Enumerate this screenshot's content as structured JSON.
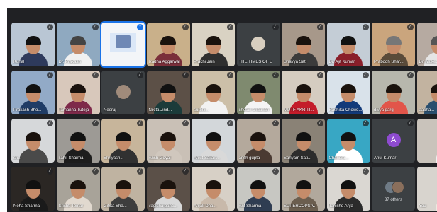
{
  "colors": {
    "grid_background": "#202124",
    "tile_background": "#3c4043",
    "accent_blue": "#1a73e8",
    "avatar_purple": "#8e4bd0"
  },
  "tiles": [
    {
      "name": "Kunal",
      "mic": "muted"
    },
    {
      "name": "Dr. Prakash",
      "mic": "muted"
    },
    {
      "name": "",
      "mic": "active"
    },
    {
      "name": "Radha Aggarwal",
      "mic": "muted"
    },
    {
      "name": "Prachi Jain",
      "mic": "muted"
    },
    {
      "name": "THE TIMES OF US",
      "mic": "muted"
    },
    {
      "name": "Bhavya Sati",
      "mic": "muted"
    },
    {
      "name": "Dr. Ajit Kumar",
      "mic": "muted"
    },
    {
      "name": "Prabodh Shar...",
      "mic": "muted"
    },
    {
      "name": "Dr. Muke...",
      "mic": "muted"
    },
    {
      "name": "Prakash Bho...",
      "mic": "muted"
    },
    {
      "name": "Tamanna Tuteja",
      "mic": "muted"
    },
    {
      "name": "Neeraj",
      "mic": "muted"
    },
    {
      "name": "Nikita Jind...",
      "mic": "muted"
    },
    {
      "name": "surbhi...",
      "mic": "muted"
    },
    {
      "name": "chetan chauhan",
      "mic": "muted"
    },
    {
      "name": "MDTF AKRITI...",
      "mic": "muted"
    },
    {
      "name": "Rashika Chowd...",
      "mic": "muted"
    },
    {
      "name": "divya garg",
      "mic": "muted"
    },
    {
      "name": "aabha...",
      "mic": "muted"
    },
    {
      "name": "sh...",
      "mic": "muted"
    },
    {
      "name": "sahil Sharma",
      "mic": "muted"
    },
    {
      "name": "Shriyash...",
      "mic": "muted"
    },
    {
      "name": "Ansh Goyal",
      "mic": "muted"
    },
    {
      "name": "Ankit Sailan...",
      "mic": "muted"
    },
    {
      "name": "ansh gupta",
      "mic": "muted"
    },
    {
      "name": "Sanyam Sati...",
      "mic": "muted"
    },
    {
      "name": "Chandra...",
      "mic": "muted"
    },
    {
      "name": "Anuj Kumar",
      "mic": "muted"
    },
    {
      "name": "",
      "mic": "muted"
    },
    {
      "name": "Neha Sharma",
      "mic": "muted"
    },
    {
      "name": "Srishti Tomar",
      "mic": "muted"
    },
    {
      "name": "Gitika Sha...",
      "mic": "muted"
    },
    {
      "name": "vagisha panc...",
      "mic": "muted"
    },
    {
      "name": "Anjali Dha...",
      "mic": "muted"
    },
    {
      "name": "Arif Sharma",
      "mic": "muted"
    },
    {
      "name": "SUPERCOPS V...",
      "mic": "muted"
    },
    {
      "name": "Tanishq Arya",
      "mic": "muted"
    },
    {
      "name": "",
      "mic": "none"
    },
    {
      "name": "You",
      "mic": "muted"
    }
  ],
  "others_text": "87 others",
  "avatar_letters": {
    "neeraj": "",
    "times": "",
    "anuj": "A"
  }
}
